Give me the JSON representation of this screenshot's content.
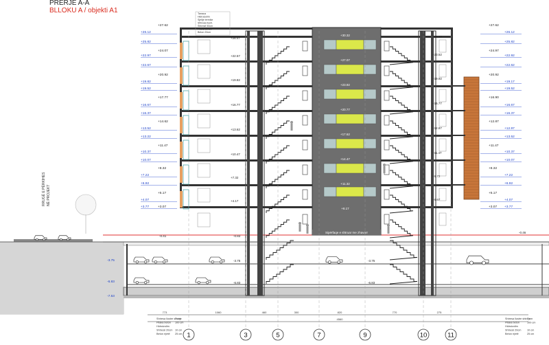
{
  "header": {
    "section_title": "PRERJE A-A",
    "subtitle": "BLLOKU A / objekti A1"
  },
  "colors": {
    "title_red": "#d9291c",
    "level_blue": "#1a3fc9",
    "core_grey": "#6e6e6e",
    "window_yellow": "#dbe84a",
    "brick_facade": "#c8763a",
    "ground_grey": "#d6d6d6",
    "level_line_red": "#e03030"
  },
  "axes": {
    "labels": [
      "1",
      "3",
      "5",
      "7",
      "9",
      "10",
      "11"
    ]
  },
  "levels_left_blue": [
    "+26.12",
    "+25.82",
    "+22.97",
    "+22.67",
    "+19.82",
    "+19.52",
    "+16.67",
    "+16.37",
    "+13.52",
    "+13.22",
    "+10.37",
    "+10.07",
    "+7.22",
    "+6.92",
    "+4.07",
    "+3.77"
  ],
  "levels_left_black": [
    "+27.62",
    "+24.07",
    "+20.92",
    "+17.77",
    "+14.62",
    "+11.47",
    "+8.32",
    "+5.17",
    "+3.07"
  ],
  "levels_inner_left": [
    "+26.47",
    "+22.57",
    "+19.82",
    "+16.77",
    "+13.62",
    "+10.47",
    "+7.32",
    "+4.17"
  ],
  "levels_right_blue": [
    "+26.12",
    "+25.82",
    "+22.92",
    "+22.62",
    "+19.17",
    "+19.52",
    "+16.67",
    "+16.37",
    "+12.97",
    "+13.52",
    "+10.37",
    "+10.07",
    "+7.22",
    "+6.92",
    "+4.07",
    "+3.77"
  ],
  "levels_right_black": [
    "+27.62",
    "+24.97",
    "+20.92",
    "+16.90",
    "+12.87",
    "+11.47",
    "+8.32",
    "+5.17",
    "+3.07"
  ],
  "levels_right_inner": [
    "+26.47",
    "+23.52",
    "+19.92",
    "+16.77",
    "+12.87",
    "+11.47",
    "+9.72",
    "+6.67",
    "+3.17"
  ],
  "core_levels": [
    "+30.32",
    "+27.07",
    "+23.92",
    "+20.77",
    "+17.62",
    "+14.47",
    "+11.32",
    "+8.17"
  ],
  "core_band_label": "Sipërfaqe e shtruar me zhavorr",
  "underground_levels_left": [
    "-3.75",
    "-6.83",
    "-7.53"
  ],
  "underground_levels_center": [
    "-3.75",
    "-6.83",
    "-3.75",
    "-6.83"
  ],
  "ground_levels": [
    "-0.41",
    "-0.83",
    "-0.46"
  ],
  "road_label": [
    "RRUGË E PËRKIHES",
    "NË PROJEKT"
  ],
  "dimension_row": [
    "773",
    "1060",
    "460",
    "300",
    "820",
    "770",
    "275"
  ],
  "dimension_total": "4560",
  "legend_rows": [
    "Shtresa llustre shtrirje",
    "Pllaka beton",
    "Hidroizolim",
    "Shtresë 20cm",
    "Beton rrjetë"
  ],
  "legend_values": [
    "7 cm",
    "100 cm",
    "",
    "10 cm",
    "25 cm"
  ],
  "top_note": [
    "Tarraca",
    "Hidroizolim",
    "Sjellje termike",
    "Shtresa llustr.",
    "Shtresë 50cm",
    "Pllaka 30x30",
    "Beton 20cm"
  ]
}
